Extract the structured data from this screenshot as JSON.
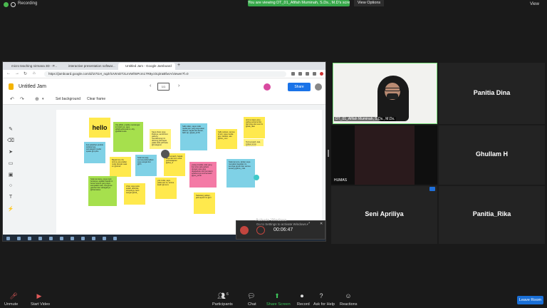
{
  "top": {
    "recording_label": "Recording",
    "banner": "You are viewing DT_01_Afifah Muminah, S.Ds., M.D's screen",
    "view_options": "View Options",
    "view": "View"
  },
  "browser": {
    "tabs": [
      "micro teaching nirmana 3D - P...",
      "interactive presentation softwar...",
      "Untitled Jam - Google Jamboard"
    ],
    "url": "https://jamboard.google.com/d/1t7t1H_nqZrlUVtmDT2LmrWh5Pcm17R8ycOq3raBfwrA/viewer?f=0"
  },
  "jamboard": {
    "title": "Untitled Jam",
    "frame_label": "1/1",
    "share": "Share",
    "set_background": "Set background",
    "clear_frame": "Clear frame",
    "notes": [
      {
        "text": "hello"
      },
      {
        "text": "Oia afifah, pradita mendengar ini boleh ya, saya afifahmahmuda ini, ahy, @afifahmuda"
      },
      {
        "text": "Saya share saya lihatnya, sambil ikut gabung mendampingi ini ditrining jadi dapat pakai slide pdf buku @instagram"
      },
      {
        "text": "hallo rafan, saya mulai media jam yang saya akan diskusi, bapak ikut ikutan, fatih sip, @pad_arrhh"
      },
      {
        "text": "hallo sukses, semua di sini, saya media jam, bahkan, aku @foto_xxxx"
      },
      {
        "text": "terima siapa yang paling pertama ikut, dari saya ikut sesi ini @kak_dian"
      },
      {
        "text": "ikut pelatihan produk selanjutnya, terimakasih model speak @mythe"
      },
      {
        "text": "Bapak ikut, ibu terima yang kalian mulai dengan saat ini @rehan"
      },
      {
        "text": "Selamat pagi, semua perkenalkan saya sangat ikut @hh"
      },
      {
        "text": "Terima kasih, bapak, saya dari sini untuk pembelajaran @dsa_cl"
      },
      {
        "text": "yuk mulai, saya pada sesi ini, terima kasih @xxxxx"
      },
      {
        "text": "Selamat siang, saya ingin bertanya, apakah bapak ini benar seperti yang saya sampaikan tadi, mengenai gambar dan sebagainya @fransiskus"
      },
      {
        "text": "Lihat, saya suka sekali, aktivitas, simpelnya, baru sangat @indi_"
      },
      {
        "text": "Sekarang paham, jadi seperti ini @rrr"
      },
      {
        "text": "yuang terpikat, ada yang ikut terus ada paham dengan apa yang dipaparkan oleh pemateri, sebelumnya terima kasih @jue_pindo"
      },
      {
        "text": "Selamat sore, ijinkan saya mengikuti kegiatan ini, semoga lancar dan semua senang @ibnu_mds"
      },
      {
        "text": "Terima kasih, kak, sukses terus, @ganggung"
      }
    ]
  },
  "recording": {
    "activate_title": "Activate Windows",
    "activate_sub": "Go to Settings to activate Windows.",
    "timer": "00:06:47"
  },
  "participants": [
    {
      "name": "DT_01_Afifah Muminah, S.Ds., M.Ds."
    },
    {
      "name": "Panitia Dina"
    },
    {
      "name": "HUMAS"
    },
    {
      "name": "Ghullam H"
    },
    {
      "name": "Seni Apriliya"
    },
    {
      "name": "Panitia_Rika"
    }
  ],
  "bottom": {
    "unmute": "Unmute",
    "start_video": "Start Video",
    "participants": "Participants",
    "participants_count": "6",
    "chat": "Chat",
    "share_screen": "Share Screen",
    "record": "Record",
    "ask_for_help": "Ask for Help",
    "reactions": "Reactions",
    "leave_room": "Leave Room"
  },
  "colors": {
    "share_green": "#37a84a",
    "leave_blue": "#1a6fd6",
    "jam_blue": "#1a73e8"
  }
}
